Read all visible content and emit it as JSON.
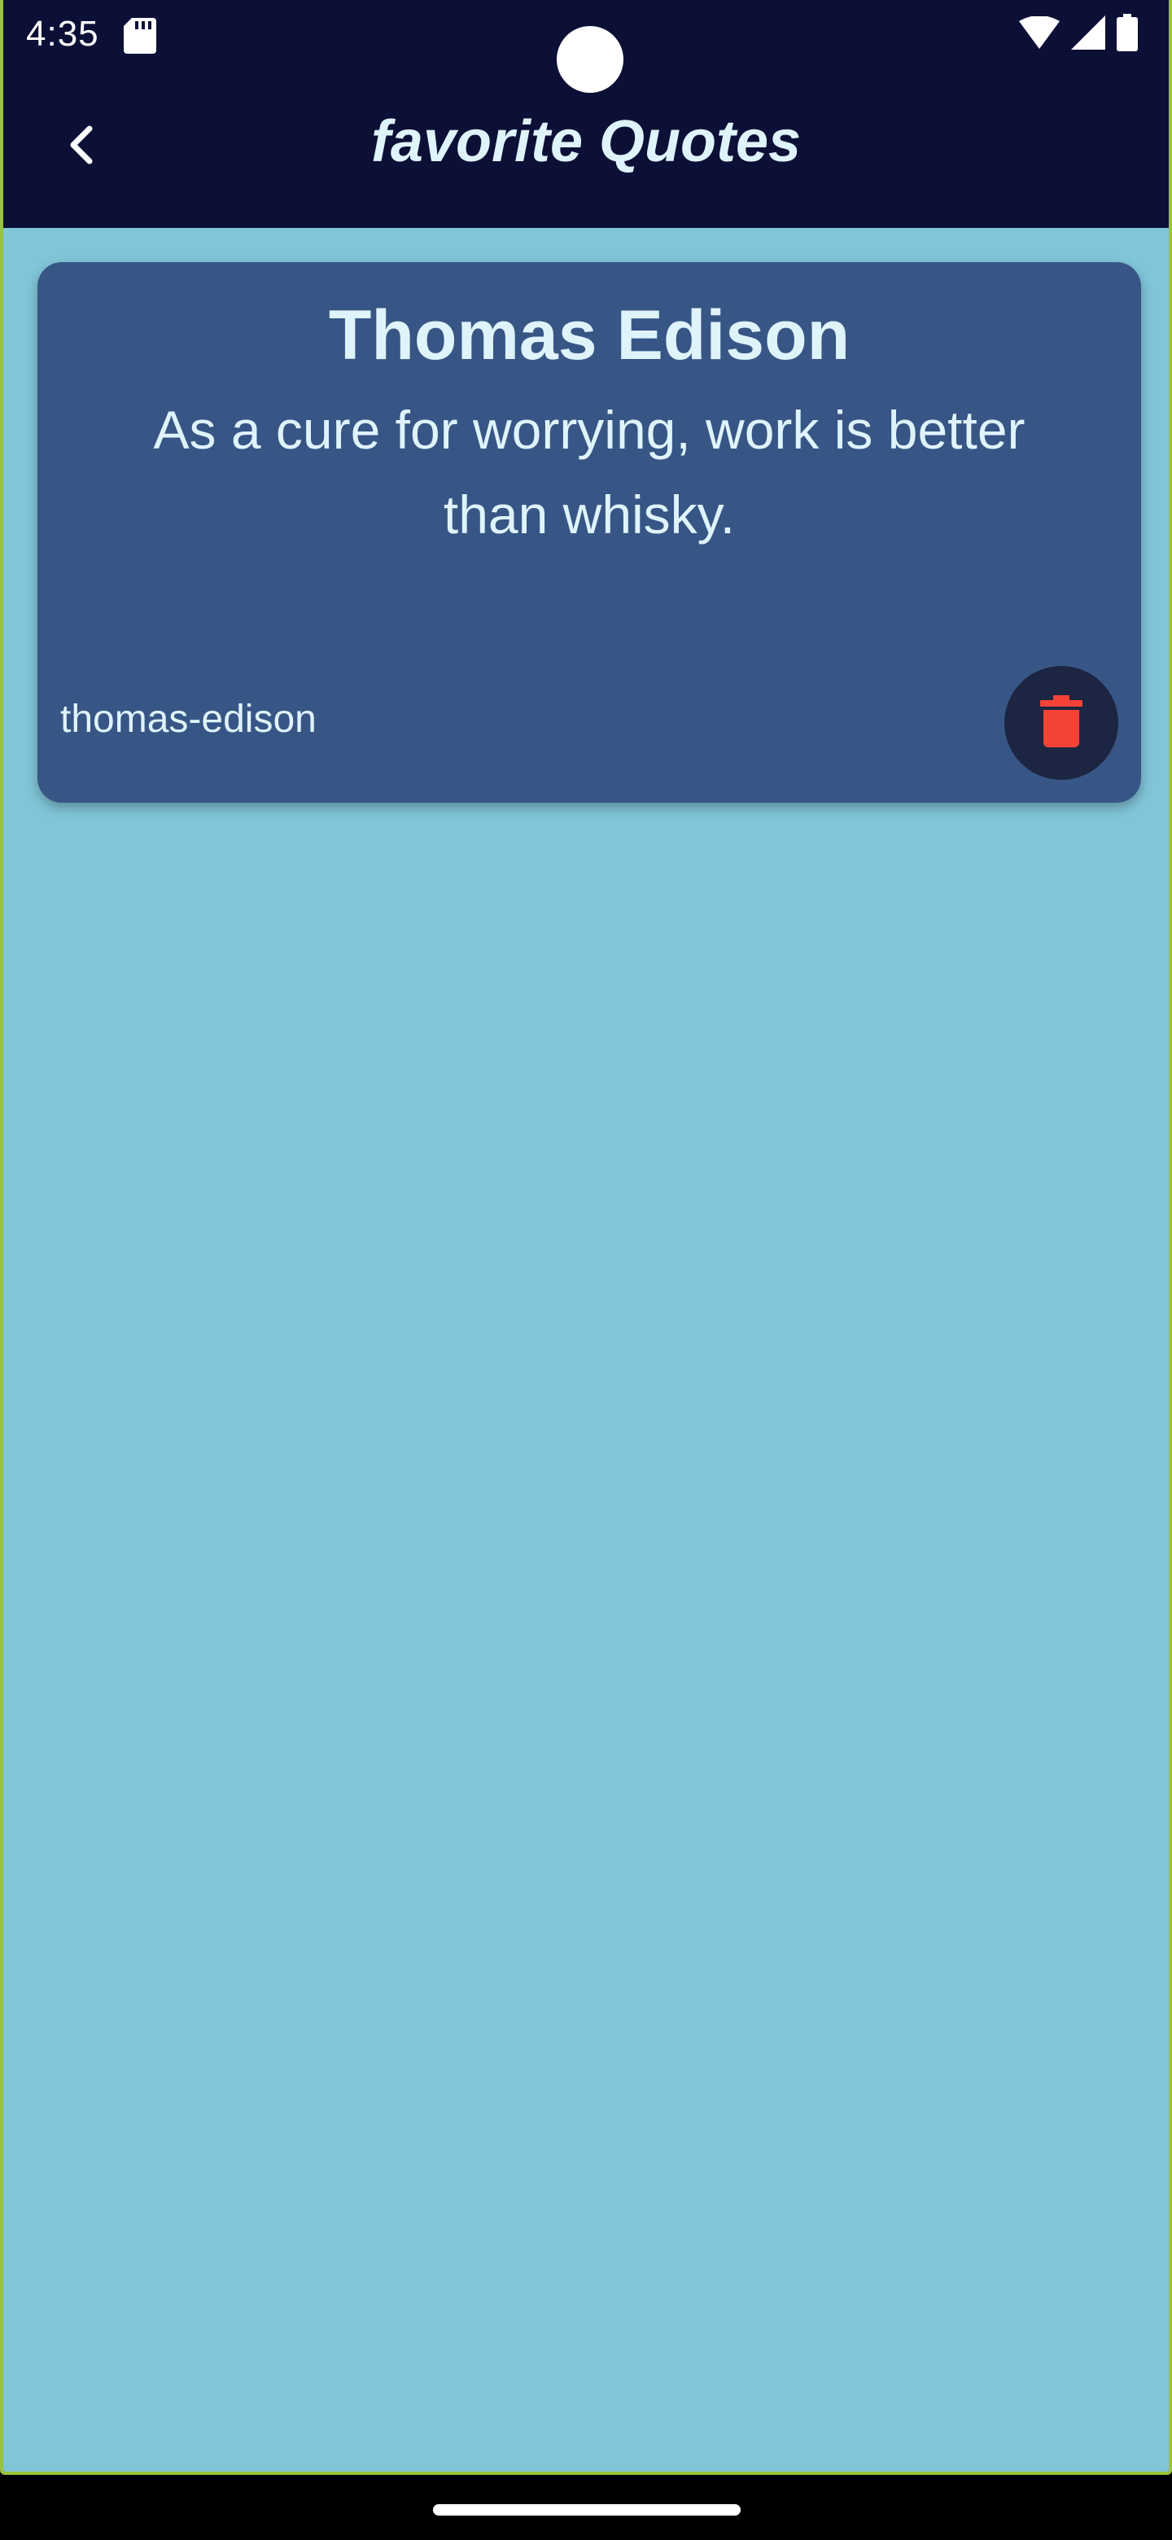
{
  "status_bar": {
    "time": "4:35",
    "icons": [
      "sd-card-icon",
      "wifi-icon",
      "cell-signal-icon",
      "battery-icon"
    ]
  },
  "app_bar": {
    "back_icon": "chevron-left-icon",
    "title": "favorite Quotes"
  },
  "quotes": [
    {
      "author": "Thomas Edison",
      "text": "As a cure for worrying, work is better than whisky.",
      "tag": "thomas-edison",
      "delete_icon": "trash-icon"
    }
  ],
  "colors": {
    "app_bar_background": "#0d1036",
    "content_background": "#80c5d8",
    "card_background": "#375685",
    "text_light": "#dff3fb",
    "delete_button_background": "#1c2541",
    "delete_icon": "#f44336"
  }
}
